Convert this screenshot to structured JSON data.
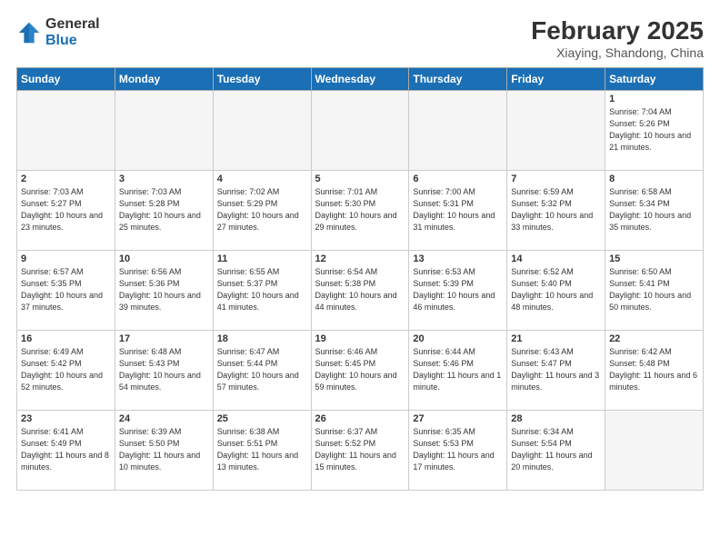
{
  "logo": {
    "general": "General",
    "blue": "Blue"
  },
  "title": "February 2025",
  "location": "Xiaying, Shandong, China",
  "days_of_week": [
    "Sunday",
    "Monday",
    "Tuesday",
    "Wednesday",
    "Thursday",
    "Friday",
    "Saturday"
  ],
  "weeks": [
    [
      {
        "day": "",
        "info": ""
      },
      {
        "day": "",
        "info": ""
      },
      {
        "day": "",
        "info": ""
      },
      {
        "day": "",
        "info": ""
      },
      {
        "day": "",
        "info": ""
      },
      {
        "day": "",
        "info": ""
      },
      {
        "day": "1",
        "info": "Sunrise: 7:04 AM\nSunset: 5:26 PM\nDaylight: 10 hours and 21 minutes."
      }
    ],
    [
      {
        "day": "2",
        "info": "Sunrise: 7:03 AM\nSunset: 5:27 PM\nDaylight: 10 hours and 23 minutes."
      },
      {
        "day": "3",
        "info": "Sunrise: 7:03 AM\nSunset: 5:28 PM\nDaylight: 10 hours and 25 minutes."
      },
      {
        "day": "4",
        "info": "Sunrise: 7:02 AM\nSunset: 5:29 PM\nDaylight: 10 hours and 27 minutes."
      },
      {
        "day": "5",
        "info": "Sunrise: 7:01 AM\nSunset: 5:30 PM\nDaylight: 10 hours and 29 minutes."
      },
      {
        "day": "6",
        "info": "Sunrise: 7:00 AM\nSunset: 5:31 PM\nDaylight: 10 hours and 31 minutes."
      },
      {
        "day": "7",
        "info": "Sunrise: 6:59 AM\nSunset: 5:32 PM\nDaylight: 10 hours and 33 minutes."
      },
      {
        "day": "8",
        "info": "Sunrise: 6:58 AM\nSunset: 5:34 PM\nDaylight: 10 hours and 35 minutes."
      }
    ],
    [
      {
        "day": "9",
        "info": "Sunrise: 6:57 AM\nSunset: 5:35 PM\nDaylight: 10 hours and 37 minutes."
      },
      {
        "day": "10",
        "info": "Sunrise: 6:56 AM\nSunset: 5:36 PM\nDaylight: 10 hours and 39 minutes."
      },
      {
        "day": "11",
        "info": "Sunrise: 6:55 AM\nSunset: 5:37 PM\nDaylight: 10 hours and 41 minutes."
      },
      {
        "day": "12",
        "info": "Sunrise: 6:54 AM\nSunset: 5:38 PM\nDaylight: 10 hours and 44 minutes."
      },
      {
        "day": "13",
        "info": "Sunrise: 6:53 AM\nSunset: 5:39 PM\nDaylight: 10 hours and 46 minutes."
      },
      {
        "day": "14",
        "info": "Sunrise: 6:52 AM\nSunset: 5:40 PM\nDaylight: 10 hours and 48 minutes."
      },
      {
        "day": "15",
        "info": "Sunrise: 6:50 AM\nSunset: 5:41 PM\nDaylight: 10 hours and 50 minutes."
      }
    ],
    [
      {
        "day": "16",
        "info": "Sunrise: 6:49 AM\nSunset: 5:42 PM\nDaylight: 10 hours and 52 minutes."
      },
      {
        "day": "17",
        "info": "Sunrise: 6:48 AM\nSunset: 5:43 PM\nDaylight: 10 hours and 54 minutes."
      },
      {
        "day": "18",
        "info": "Sunrise: 6:47 AM\nSunset: 5:44 PM\nDaylight: 10 hours and 57 minutes."
      },
      {
        "day": "19",
        "info": "Sunrise: 6:46 AM\nSunset: 5:45 PM\nDaylight: 10 hours and 59 minutes."
      },
      {
        "day": "20",
        "info": "Sunrise: 6:44 AM\nSunset: 5:46 PM\nDaylight: 11 hours and 1 minute."
      },
      {
        "day": "21",
        "info": "Sunrise: 6:43 AM\nSunset: 5:47 PM\nDaylight: 11 hours and 3 minutes."
      },
      {
        "day": "22",
        "info": "Sunrise: 6:42 AM\nSunset: 5:48 PM\nDaylight: 11 hours and 6 minutes."
      }
    ],
    [
      {
        "day": "23",
        "info": "Sunrise: 6:41 AM\nSunset: 5:49 PM\nDaylight: 11 hours and 8 minutes."
      },
      {
        "day": "24",
        "info": "Sunrise: 6:39 AM\nSunset: 5:50 PM\nDaylight: 11 hours and 10 minutes."
      },
      {
        "day": "25",
        "info": "Sunrise: 6:38 AM\nSunset: 5:51 PM\nDaylight: 11 hours and 13 minutes."
      },
      {
        "day": "26",
        "info": "Sunrise: 6:37 AM\nSunset: 5:52 PM\nDaylight: 11 hours and 15 minutes."
      },
      {
        "day": "27",
        "info": "Sunrise: 6:35 AM\nSunset: 5:53 PM\nDaylight: 11 hours and 17 minutes."
      },
      {
        "day": "28",
        "info": "Sunrise: 6:34 AM\nSunset: 5:54 PM\nDaylight: 11 hours and 20 minutes."
      },
      {
        "day": "",
        "info": ""
      }
    ]
  ]
}
